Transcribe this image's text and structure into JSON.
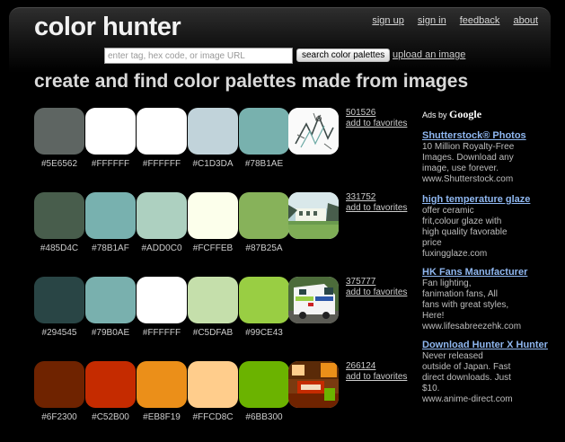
{
  "header": {
    "logo": "color hunter",
    "links": [
      "sign up",
      "sign in",
      "feedback",
      "about"
    ],
    "search_placeholder": "enter tag, hex code, or image URL",
    "search_button": "search color palettes",
    "upload_link": "upload an image"
  },
  "tagline": "create and find color palettes made from images",
  "palettes": [
    {
      "id": "501526",
      "favorite": "add to favorites",
      "swatches": [
        "#5E6562",
        "#FFFFFF",
        "#FFFFFF",
        "#C1D3DA",
        "#78B1AE"
      ],
      "image": "sketch drawing"
    },
    {
      "id": "331752",
      "favorite": "add to favorites",
      "swatches": [
        "#485D4C",
        "#78B1AF",
        "#ADD0C0",
        "#FCFFEB",
        "#87B25A"
      ],
      "image": "landscape building"
    },
    {
      "id": "375777",
      "favorite": "add to favorites",
      "swatches": [
        "#294545",
        "#79B0AE",
        "#FFFFFF",
        "#C5DFAB",
        "#99CE43"
      ],
      "image": "ambulance"
    },
    {
      "id": "266124",
      "favorite": "add to favorites",
      "swatches": [
        "#6F2300",
        "#C52B00",
        "#EB8F19",
        "#FFCD8C",
        "#6BB300"
      ],
      "image": "room interior"
    }
  ],
  "ads": {
    "label_prefix": "Ads by",
    "label_brand": "Google",
    "items": [
      {
        "title": "Shutterstock® Photos",
        "lines": [
          "10 Million Royalty-Free",
          "Images. Download any",
          "image, use forever."
        ],
        "url": "www.Shutterstock.com"
      },
      {
        "title": "high temperature glaze",
        "lines": [
          "offer ceramic",
          "frit,colour glaze with",
          "high quality favorable",
          "price"
        ],
        "url": "fuxingglaze.com"
      },
      {
        "title": "HK Fans Manufacturer",
        "lines": [
          "Fan lighting,",
          "fanimation fans, All",
          "fans with great styles,",
          "Here!"
        ],
        "url": "www.lifesabreezehk.com"
      },
      {
        "title": "Download Hunter X Hunter",
        "lines": [
          "Never released",
          "outside of Japan. Fast",
          "direct downloads. Just",
          "$10."
        ],
        "url": "www.anime-direct.com"
      }
    ]
  }
}
